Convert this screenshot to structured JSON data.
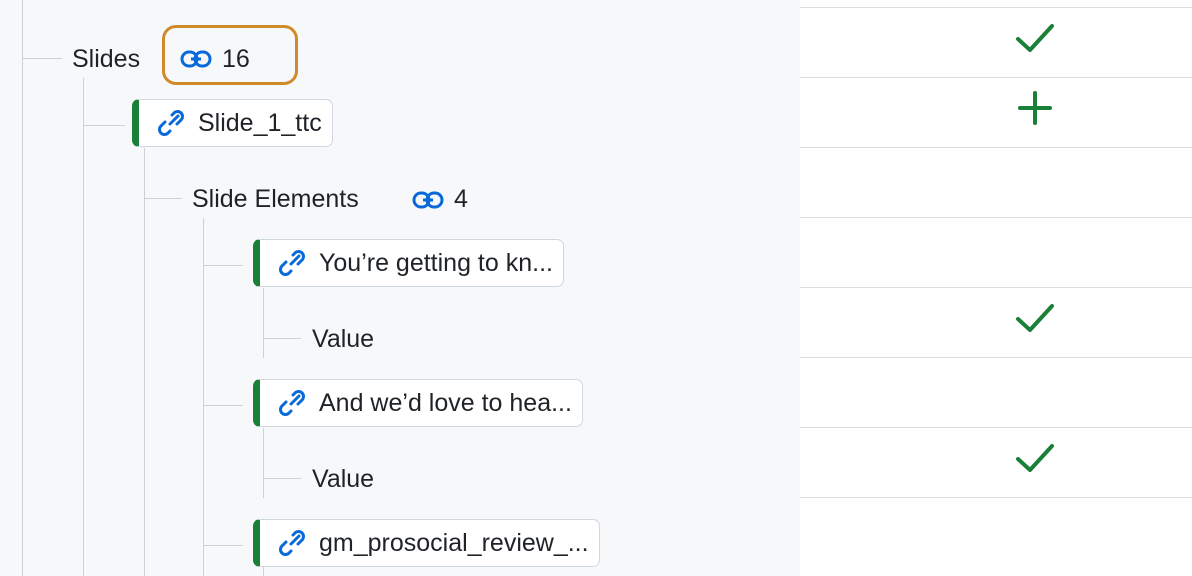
{
  "tree": {
    "slides": {
      "label": "Slides",
      "count": "16"
    },
    "slide_1": {
      "label": "Slide_1_ttc"
    },
    "slide_elements": {
      "label": "Slide Elements",
      "count": "4"
    },
    "element_1": {
      "label": "You’re getting to kn...",
      "value_label": "Value"
    },
    "element_2": {
      "label": "And we’d love to hea...",
      "value_label": "Value"
    },
    "element_3": {
      "label": "gm_prosocial_review_..."
    }
  },
  "status_column": {
    "rows": [
      {
        "icon": "checkmark-icon"
      },
      {
        "icon": "plus-icon"
      },
      {
        "icon": "none"
      },
      {
        "icon": "none"
      },
      {
        "icon": "checkmark-icon"
      },
      {
        "icon": "none"
      },
      {
        "icon": "checkmark-icon"
      },
      {
        "icon": "none"
      }
    ]
  },
  "colors": {
    "accent_green": "#1a7f37",
    "link_blue": "#0969da",
    "highlight_orange": "#d08a2a",
    "tree_background": "#f6f8fa"
  }
}
